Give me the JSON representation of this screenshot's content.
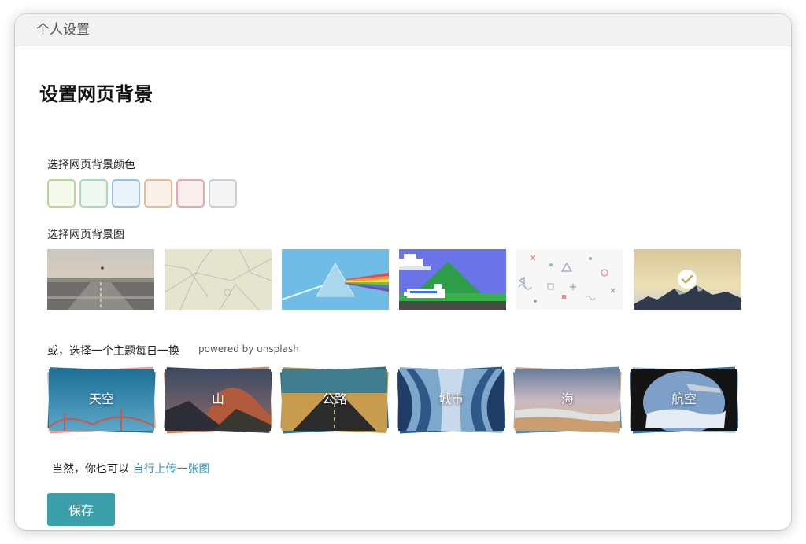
{
  "window": {
    "title": "个人设置"
  },
  "page": {
    "title": "设置网页背景"
  },
  "colors": {
    "label": "选择网页背景颜色",
    "swatches": [
      {
        "name": "green",
        "fill": "#f4f9ec",
        "border": "#b7d69a"
      },
      {
        "name": "mint",
        "fill": "#eef8f1",
        "border": "#a9d9b8"
      },
      {
        "name": "blue",
        "fill": "#eaf3fa",
        "border": "#98c2df"
      },
      {
        "name": "peach",
        "fill": "#fcf1e8",
        "border": "#e6bb99"
      },
      {
        "name": "pink",
        "fill": "#fbeeee",
        "border": "#e3aaa9"
      },
      {
        "name": "gray",
        "fill": "#f4f4f4",
        "border": "#cfcfcf"
      }
    ]
  },
  "backgrounds": {
    "label": "选择网页背景图",
    "items": [
      "runway",
      "map",
      "prism",
      "pixel-plane",
      "confetti",
      "mountain"
    ],
    "selected": "mountain"
  },
  "themes": {
    "label": "或，选择一个主题每日一换",
    "powered": "powered by unsplash",
    "items": [
      {
        "label": "天空"
      },
      {
        "label": "山"
      },
      {
        "label": "公路"
      },
      {
        "label": "城市"
      },
      {
        "label": "海"
      },
      {
        "label": "航空"
      }
    ]
  },
  "upload": {
    "prefix": "当然，你也可以 ",
    "link": "自行上传一张图"
  },
  "save_label": "保存"
}
